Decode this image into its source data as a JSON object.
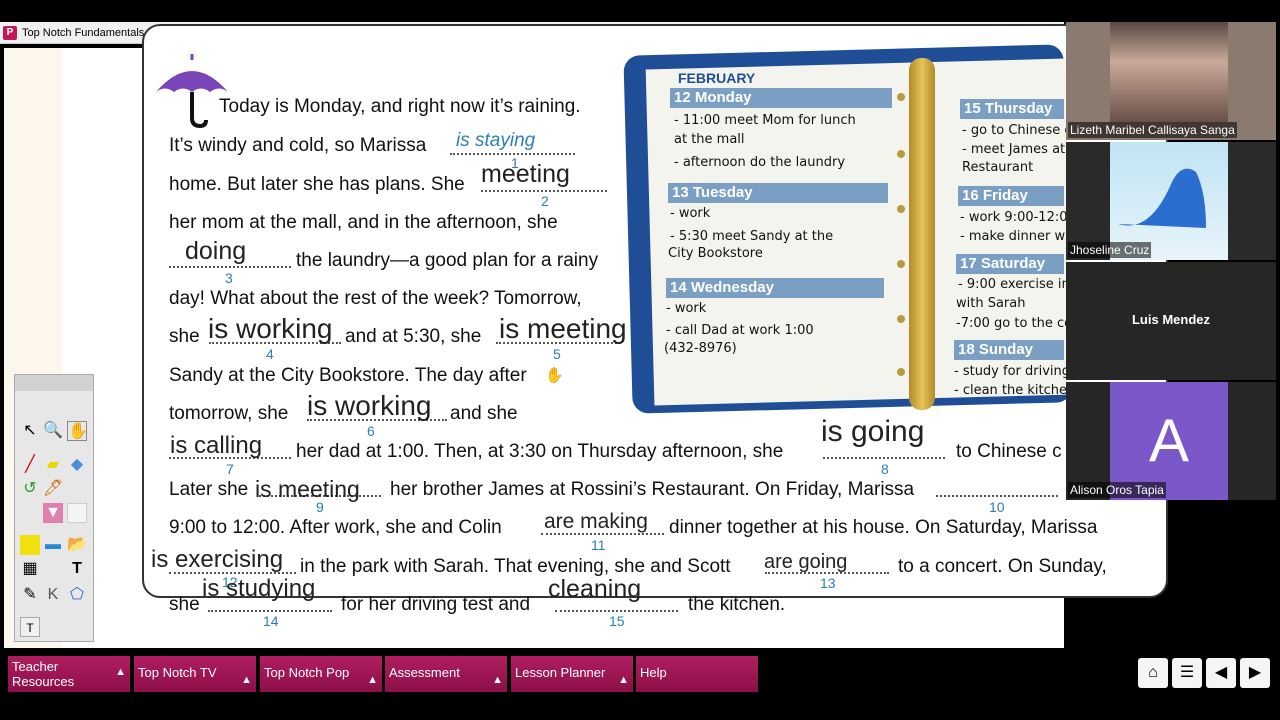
{
  "window": {
    "title": "Top Notch Fundamentals",
    "app_icon": "P"
  },
  "reading": {
    "l1": "Today is Monday, and right now it’s raining.",
    "l2a": "It’s windy and cold, so Marissa",
    "l3a": "home. But later she has plans. She",
    "l4a": "her mom at the mall, and in the afternoon, she",
    "l5b": "the laundry—a good plan for a rainy",
    "l6": "day! What about the rest of the week? Tomorrow,",
    "l7a": "she",
    "l7b": "and at 5:30, she",
    "l8": "Sandy at the City Bookstore. The day after",
    "l9a": "tomorrow, she",
    "l9b": "and she",
    "l10b": "her dad at 1:00. Then, at 3:30 on Thursday afternoon, she",
    "l10c": "to Chinese c",
    "l11a": "Later she",
    "l11b": "her brother James at Rossini’s Restaurant. On Friday, Marissa",
    "l12a": "9:00 to 12:00. After work, she and Colin",
    "l12b": "dinner together at his house. On Saturday, Marissa",
    "l13b": "in the park with Sarah. That evening, she and Scott",
    "l13c": "to a concert. On Sunday,",
    "l14a": "she",
    "l14b": "for her driving test and",
    "l14c": "the kitchen."
  },
  "blanks": {
    "n1": "1",
    "n2": "2",
    "n3": "3",
    "n4": "4",
    "n5": "5",
    "n6": "6",
    "n7": "7",
    "n8": "8",
    "n9": "9",
    "n10": "10",
    "n11": "11",
    "n12": "12",
    "n13": "13",
    "n14": "14",
    "n15": "15"
  },
  "answers": {
    "a1": "is staying",
    "a2": "meeting",
    "a3": "doing",
    "a4": "is working",
    "a5": "is meeting",
    "a6": "is working",
    "a7": "is calling",
    "a8": "is going",
    "a9": "is meeting",
    "a11": "are making",
    "a12": "is exercising",
    "a13": "are going",
    "a14": "is studying",
    "a15": "cleaning"
  },
  "planner": {
    "month": "FEBRUARY",
    "d12": "12 Monday",
    "d12a": "- 11:00 meet Mom for lunch",
    "d12b": "at the mall",
    "d12c": "- afternoon do the laundry",
    "d13": "13 Tuesday",
    "d13a": "- work",
    "d13b": "- 5:30 meet Sandy at the",
    "d13c": "City Bookstore",
    "d14": "14 Wednesday",
    "d14a": "- work",
    "d14b": "- call Dad at work 1:00",
    "d14c": "(432-8976)",
    "d15": "15 Thursday",
    "d15a": "- go to Chinese c",
    "d15b": "- meet James at",
    "d15c": "Restaurant",
    "d16": "16 Friday",
    "d16a": "- work 9:00-12:00",
    "d16b": "- make dinner with",
    "d17": "17 Saturday",
    "d17a": "- 9:00 exercise in",
    "d17b": "with Sarah",
    "d17c": "-7:00 go to the co",
    "d18": "18 Sunday",
    "d18a": "- study for driving",
    "d18b": "- clean the kitchen"
  },
  "toolbox": {
    "text_tool": "T",
    "k_tool": "K",
    "small_t": "T"
  },
  "bottom_menu": [
    {
      "label": "Teacher Resources"
    },
    {
      "label": "Top Notch TV"
    },
    {
      "label": "Top Notch Pop"
    },
    {
      "label": "Assessment"
    },
    {
      "label": "Lesson Planner"
    },
    {
      "label": "Help"
    }
  ],
  "menu_arrow": "▲",
  "participants": [
    {
      "name": "Lizeth Maribel Callisaya Sanga"
    },
    {
      "name": "Jhoseline Cruz"
    },
    {
      "name": "Luis Mendez"
    },
    {
      "name": "Alison Oros Tapia",
      "initial": "A",
      "color": "#7b58c9"
    }
  ],
  "colors": {
    "accent": "#9c1553",
    "planner_blue": "#1f4e96",
    "number_blue": "#2a7fb8"
  }
}
